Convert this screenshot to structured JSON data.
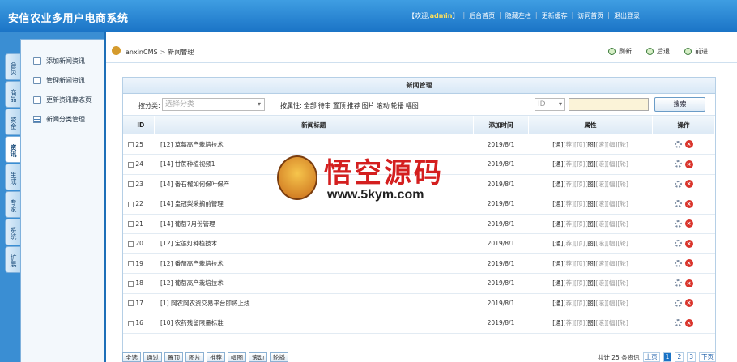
{
  "app": {
    "title": "安信农业多用户电商系统"
  },
  "topnav": {
    "welcome_prefix": "【欢迎,",
    "user": "admin",
    "welcome_suffix": "】",
    "links": [
      "后台首页",
      "隐藏左栏",
      "更新缓存",
      "访问首页",
      "退出登录"
    ]
  },
  "sidebar": {
    "tabs": [
      "会员",
      "商品",
      "资金",
      "资讯",
      "生成",
      "专家",
      "系统",
      "扩展"
    ],
    "active_tab": "资讯",
    "menu": [
      {
        "label": "添加新闻资讯",
        "icon": "folder-doc-icon"
      },
      {
        "label": "管理新闻资讯",
        "icon": "fs-doc-icon"
      },
      {
        "label": "更新资讯静态页",
        "icon": "fs-doc-icon"
      },
      {
        "label": "新闻分类管理",
        "icon": "list-icon"
      }
    ]
  },
  "breadcrumb": {
    "root": "anxinCMS",
    "sep": ">",
    "current": "新闻管理"
  },
  "toolbar": {
    "refresh": "刷新",
    "back": "后退",
    "forward": "前进"
  },
  "panel": {
    "title": "新闻管理"
  },
  "filter": {
    "category_label": "按分类:",
    "category_placeholder": "选择分类",
    "attr_label": "按属性:",
    "attrs": [
      "全部",
      "待审",
      "置顶",
      "推荐",
      "图片",
      "滚动",
      "轮播",
      "幅图"
    ],
    "field": "ID",
    "search_button": "搜索"
  },
  "table": {
    "headers": {
      "id": "ID",
      "title": "新闻标题",
      "time": "添加时间",
      "attr": "属性",
      "op": "操作"
    },
    "rows": [
      {
        "id": "25",
        "cat": "[12]",
        "title": "草莓高产栽培技术",
        "time": "2019/8/1"
      },
      {
        "id": "24",
        "cat": "[14]",
        "title": "甘蔗种植视频1",
        "time": "2019/8/1"
      },
      {
        "id": "23",
        "cat": "[14]",
        "title": "番石榴如何保叶保产",
        "time": "2019/8/1"
      },
      {
        "id": "22",
        "cat": "[14]",
        "title": "皇冠梨采摘前管理",
        "time": "2019/8/1"
      },
      {
        "id": "21",
        "cat": "[14]",
        "title": "葡萄7月份管理",
        "time": "2019/8/1"
      },
      {
        "id": "20",
        "cat": "[12]",
        "title": "宝莲灯种植技术",
        "time": "2019/8/1"
      },
      {
        "id": "19",
        "cat": "[12]",
        "title": "番茄高产栽培技术",
        "time": "2019/8/1"
      },
      {
        "id": "18",
        "cat": "[12]",
        "title": "葡萄高产栽培技术",
        "time": "2019/8/1"
      },
      {
        "id": "17",
        "cat": "[1]",
        "title": "网农网农资交易平台即将上线",
        "time": "2019/8/1"
      },
      {
        "id": "16",
        "cat": "[10]",
        "title": "农药残留限量标准",
        "time": "2019/8/1"
      }
    ],
    "attr_flags": [
      "[通]",
      "[荐]",
      "[顶]",
      "[图]",
      "[滚]",
      "[幅]",
      "[轮]"
    ]
  },
  "bulk": [
    "全选",
    "通过",
    "置顶",
    "图片",
    "推荐",
    "幅图",
    "滚动",
    "轮播"
  ],
  "pager": {
    "total": "共计 25 条资讯",
    "prev": "上页",
    "pages": [
      "1",
      "2",
      "3"
    ],
    "current": "1",
    "next": "下页"
  },
  "watermark": {
    "title": "悟空源码",
    "url": "www.5kym.com"
  }
}
